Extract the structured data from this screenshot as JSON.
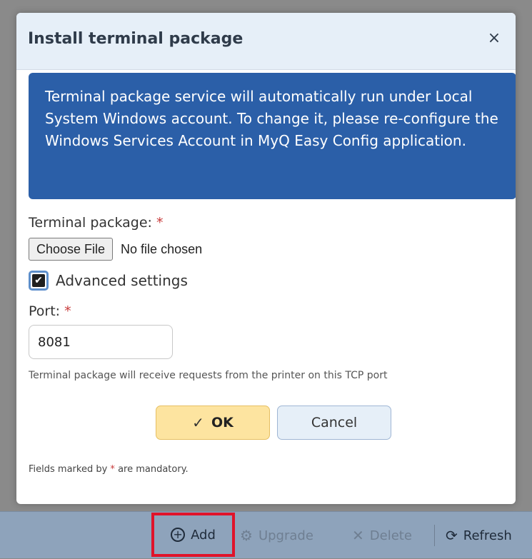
{
  "dialog": {
    "title": "Install terminal package",
    "close_glyph": "×",
    "info_text": "Terminal package service will automatically run under Local System Windows account. To change it, please re-configure the Windows Services Account in MyQ Easy Config application.",
    "terminal_package_label": "Terminal package:",
    "required_marker": "*",
    "choose_file_label": "Choose File",
    "no_file_text": "No file chosen",
    "advanced_settings_label": "Advanced settings",
    "advanced_settings_checked": true,
    "port_label": "Port:",
    "port_value": "8081",
    "port_hint": "Terminal package will receive requests from the printer on this TCP port",
    "ok_label": "OK",
    "cancel_label": "Cancel",
    "mandatory_prefix": "Fields marked by",
    "mandatory_suffix": "are mandatory."
  },
  "toolbar": {
    "add_label": "Add",
    "upgrade_label": "Upgrade",
    "delete_label": "Delete",
    "refresh_label": "Refresh"
  },
  "icons": {
    "close": "close-icon",
    "check": "check-icon",
    "add": "plus-circle-icon",
    "upgrade": "gear-icon",
    "delete": "x-icon",
    "refresh": "refresh-icon"
  },
  "colors": {
    "info_bg": "#2b5fa8",
    "ok_bg": "#fde4a0",
    "cancel_bg": "#e6eff8",
    "highlight": "#e0132a",
    "required": "#c83b3b"
  }
}
